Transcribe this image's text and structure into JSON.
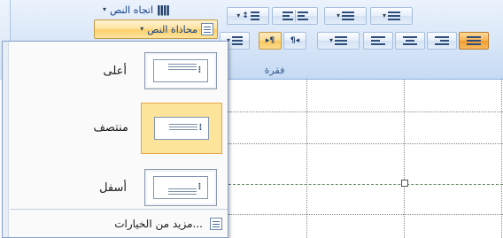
{
  "ribbon": {
    "text_direction_label": "اتجاه النص",
    "text_direction_icon": "text-direction-icon",
    "text_align_label": "محاذاة النص",
    "text_align_icon": "text-align-icon",
    "group_label": "فقرة",
    "dropdown_arrow": "▾",
    "ltr_mark": "▸¶",
    "rtl_mark": "¶◂"
  },
  "menu": {
    "options": [
      {
        "label": "أعلى",
        "icon": "align-top-icon",
        "selected": false
      },
      {
        "label": "منتصف",
        "icon": "align-middle-icon",
        "selected": true
      },
      {
        "label": "أسفل",
        "icon": "align-bottom-icon",
        "selected": false
      }
    ],
    "more_options_label": "مزيد من الخيارات...",
    "more_options_icon": "more-options-icon"
  },
  "colors": {
    "ribbon_bg": "#d8e6f8",
    "selected_bg": "#fde49b",
    "selected_border": "#e6a64a",
    "label_blue": "#15428b"
  }
}
